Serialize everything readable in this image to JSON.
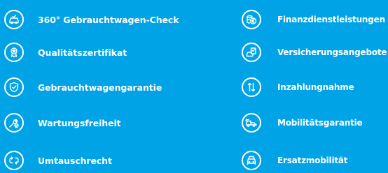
{
  "theme": {
    "background": "#00a3e6",
    "foreground": "#ffffff"
  },
  "left_column": {
    "items": [
      {
        "label": "360° Gebrauchtwagen-Check",
        "icon": "car-check-icon"
      },
      {
        "label": "Qualitätszertifikat",
        "icon": "certificate-icon"
      },
      {
        "label": "Gebrauchtwagengarantie",
        "icon": "shield-check-icon"
      },
      {
        "label": "Wartungsfreiheit",
        "icon": "wrench-check-icon"
      },
      {
        "label": "Umtauschrecht",
        "icon": "exchange-arrows-icon"
      }
    ]
  },
  "right_column": {
    "items": [
      {
        "label": "Finanzdienstleistungen",
        "icon": "coins-euro-icon"
      },
      {
        "label": "Versicherungsangebote",
        "icon": "car-document-icon"
      },
      {
        "label": "Inzahlungnahme",
        "icon": "up-down-arrows-icon"
      },
      {
        "label": "Mobilitätsgarantie",
        "icon": "tow-truck-icon"
      },
      {
        "label": "Ersatzmobilität",
        "icon": "cars-icon"
      }
    ]
  }
}
